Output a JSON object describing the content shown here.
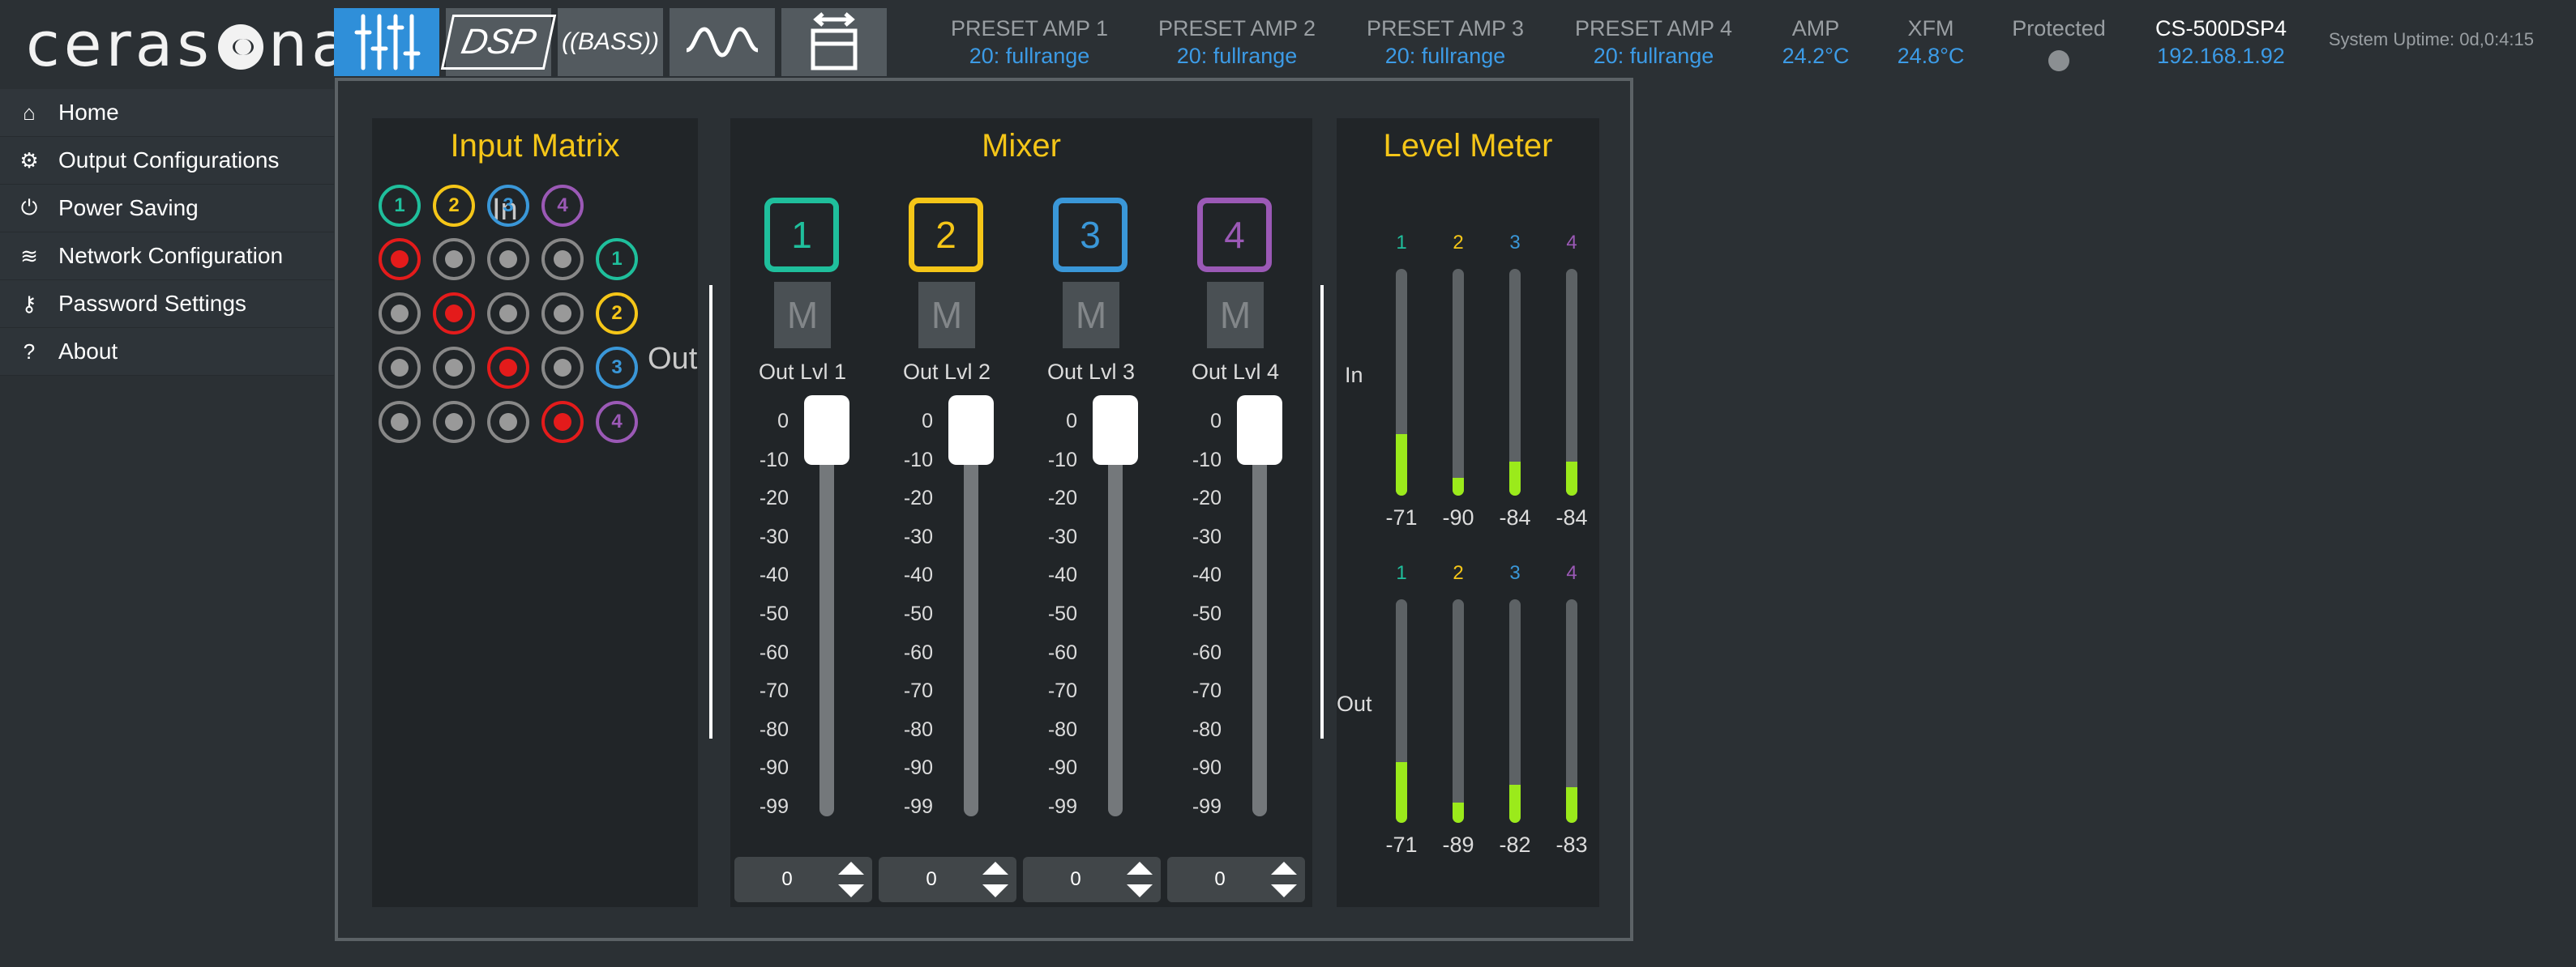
{
  "logo": {
    "text_before": "cerasо",
    "text_after": "nar",
    "full": "cerasonar"
  },
  "tabs": [
    {
      "name": "mixer",
      "icon": "mixer-sliders-icon",
      "active": true
    },
    {
      "name": "dsp",
      "label": "DSP",
      "icon": "dsp-icon",
      "active": false
    },
    {
      "name": "bass",
      "label": "BASS",
      "icon": "bass-icon",
      "active": false
    },
    {
      "name": "waveform",
      "icon": "waveform-icon",
      "active": false
    },
    {
      "name": "resize",
      "icon": "expand-frame-icon",
      "active": false
    }
  ],
  "header": {
    "presets": [
      {
        "label": "PRESET AMP 1",
        "value": "20: fullrange"
      },
      {
        "label": "PRESET AMP 2",
        "value": "20: fullrange"
      },
      {
        "label": "PRESET AMP 3",
        "value": "20: fullrange"
      },
      {
        "label": "PRESET AMP 4",
        "value": "20: fullrange"
      }
    ],
    "amp": {
      "label": "AMP",
      "value": "24.2°C"
    },
    "xfm": {
      "label": "XFM",
      "value": "24.8°C"
    },
    "protected": {
      "label": "Protected",
      "state": "off"
    },
    "device": {
      "name": "CS-500DSP4",
      "ip": "192.168.1.92"
    },
    "uptime": "System Uptime: 0d,0:4:15"
  },
  "sidebar": {
    "items": [
      {
        "label": "Home",
        "icon": "home-icon",
        "glyph": "⌂"
      },
      {
        "label": "Output Configurations",
        "icon": "gear-icon",
        "glyph": "⚙"
      },
      {
        "label": "Power Saving",
        "icon": "power-icon",
        "glyph": "⏻"
      },
      {
        "label": "Network Configuration",
        "icon": "wifi-icon",
        "glyph": "≋"
      },
      {
        "label": "Password Settings",
        "icon": "key-icon",
        "glyph": "⚷"
      },
      {
        "label": "About",
        "icon": "question-icon",
        "glyph": "?"
      }
    ]
  },
  "colors": {
    "ch1": "#1fbf9c",
    "ch2": "#f5c618",
    "ch3": "#3a97d8",
    "ch4": "#9b59b6",
    "title": "#f5c618",
    "active_tab": "#2f8fd9",
    "meter_fill": "#9bea1b",
    "matrix_on": "#e41b1b"
  },
  "input_matrix": {
    "title": "Input Matrix",
    "in_label": "In",
    "out_label": "Out",
    "inputs": [
      "1",
      "2",
      "3",
      "4"
    ],
    "outputs": [
      "1",
      "2",
      "3",
      "4"
    ],
    "routing": [
      [
        true,
        false,
        false,
        false
      ],
      [
        false,
        true,
        false,
        false
      ],
      [
        false,
        false,
        true,
        false
      ],
      [
        false,
        false,
        false,
        true
      ]
    ]
  },
  "mixer": {
    "title": "Mixer",
    "scale": [
      "0",
      "-10",
      "-20",
      "-30",
      "-40",
      "-50",
      "-60",
      "-70",
      "-80",
      "-90",
      "-99"
    ],
    "channels": [
      {
        "number": "1",
        "mute": "M",
        "label": "Out Lvl 1",
        "value": "0"
      },
      {
        "number": "2",
        "mute": "M",
        "label": "Out Lvl 2",
        "value": "0"
      },
      {
        "number": "3",
        "mute": "M",
        "label": "Out Lvl 3",
        "value": "0"
      },
      {
        "number": "4",
        "mute": "M",
        "label": "Out Lvl 4",
        "value": "0"
      }
    ]
  },
  "level_meter": {
    "title": "Level Meter",
    "in_label": "In",
    "out_label": "Out",
    "in": [
      {
        "ch": "1",
        "value": "-71",
        "fill": 0.27
      },
      {
        "ch": "2",
        "value": "-90",
        "fill": 0.08
      },
      {
        "ch": "3",
        "value": "-84",
        "fill": 0.15
      },
      {
        "ch": "4",
        "value": "-84",
        "fill": 0.15
      }
    ],
    "out": [
      {
        "ch": "1",
        "value": "-71",
        "fill": 0.27
      },
      {
        "ch": "2",
        "value": "-89",
        "fill": 0.09
      },
      {
        "ch": "3",
        "value": "-82",
        "fill": 0.17
      },
      {
        "ch": "4",
        "value": "-83",
        "fill": 0.16
      }
    ]
  }
}
